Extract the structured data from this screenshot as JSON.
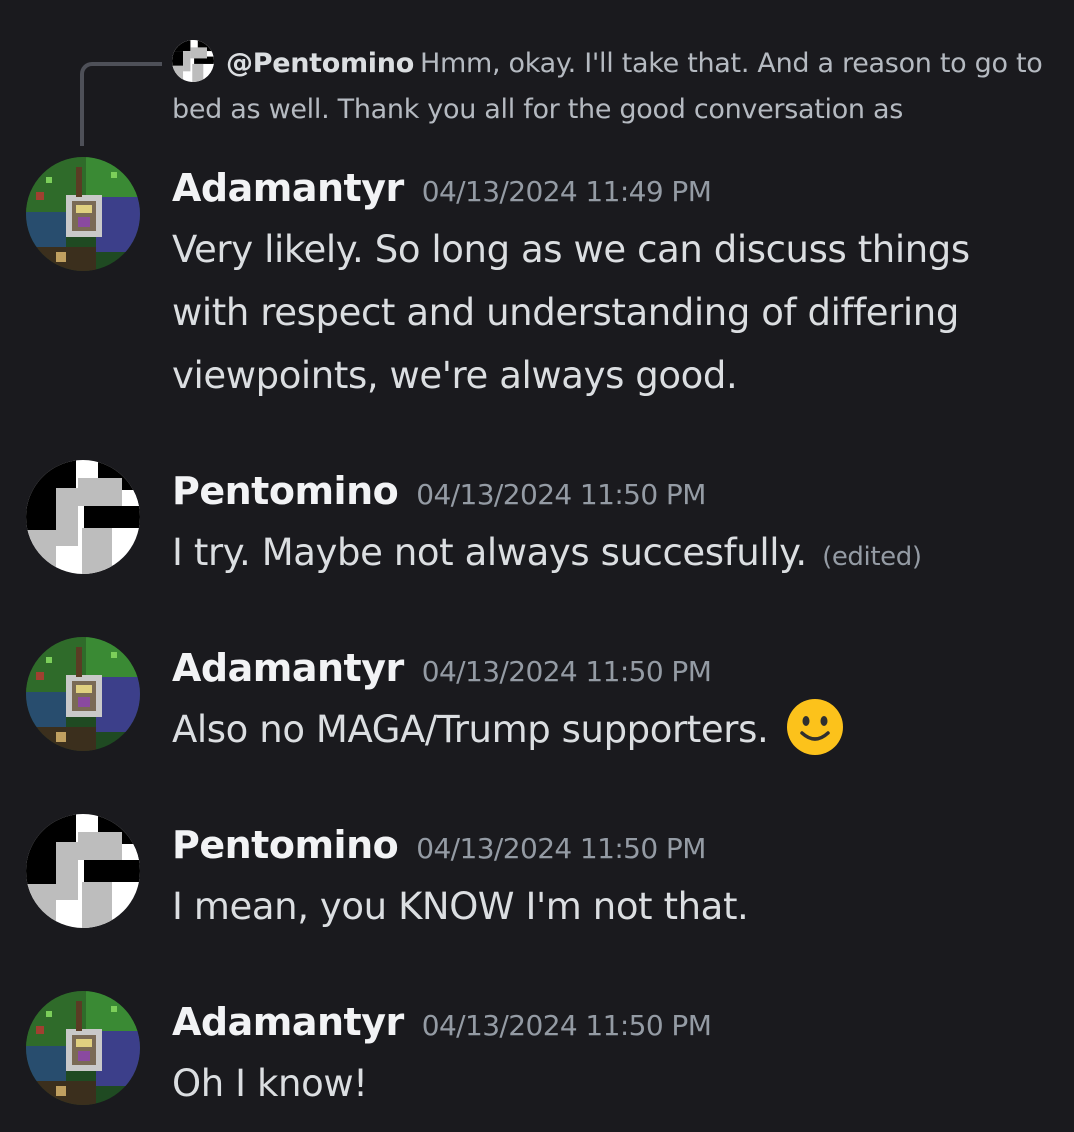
{
  "reply": {
    "author": "@Pentomino",
    "text": "Hmm, okay. I'll take that. And a reason to go to bed as well. Thank you all for the good conversation as"
  },
  "messages": [
    {
      "username": "Adamantyr",
      "timestamp": "04/13/2024 11:49 PM",
      "text": "Very likely. So long as we can discuss things with respect and understanding of differing viewpoints, we're always good.",
      "avatar": "adamantyr-avatar"
    },
    {
      "username": "Pentomino",
      "timestamp": "04/13/2024 11:50 PM",
      "text": "I try. Maybe not always succesfully.",
      "edited": "(edited)",
      "avatar": "pentomino-avatar"
    },
    {
      "username": "Adamantyr",
      "timestamp": "04/13/2024 11:50 PM",
      "text": "Also no MAGA/Trump supporters.",
      "emoji": "slightly-smiling-face-icon",
      "avatar": "adamantyr-avatar"
    },
    {
      "username": "Pentomino",
      "timestamp": "04/13/2024 11:50 PM",
      "text": "I mean, you KNOW I'm not that.",
      "avatar": "pentomino-avatar"
    },
    {
      "username": "Adamantyr",
      "timestamp": "04/13/2024 11:50 PM",
      "text": "Oh I know!",
      "avatar": "adamantyr-avatar"
    }
  ],
  "colors": {
    "background": "#1a1a1e",
    "username": "#f2f3f5",
    "text": "#dbdee1",
    "muted": "#949ba4",
    "reply_line": "#4e5058"
  }
}
